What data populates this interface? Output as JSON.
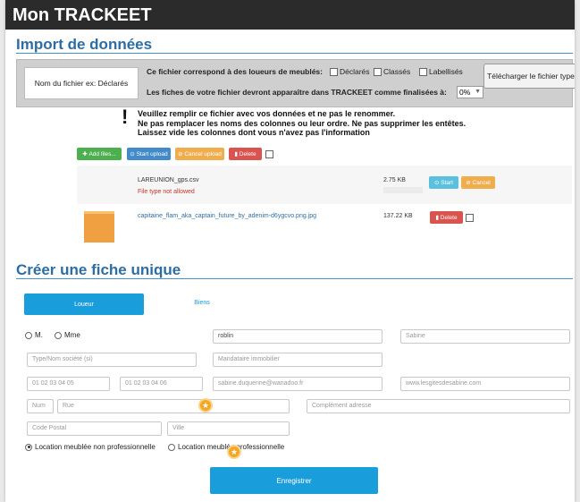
{
  "header": {
    "title": "Mon TRACKEET"
  },
  "import": {
    "heading": "Import de données",
    "file_name_label": "Nom du fichier ex: Déclarés",
    "question1": "Ce fichier correspond à des loueurs de meublés:",
    "options": [
      "Déclarés",
      "Classés",
      "Labellisés"
    ],
    "question2": "Les fiches de votre fichier devront apparaître dans TRACKEET comme finalisées à:",
    "percent_value": "0%",
    "download_button": "Télécharger le fichier type",
    "instructions": [
      "Veuillez remplir ce fichier avec vos données et ne pas le renommer.",
      "Ne pas remplacer les noms des colonnes ou leur ordre. Ne pas supprimer les entêtes.",
      "Laissez vide les colonnes dont vous n'avez pas l'information"
    ],
    "toolbar": {
      "add": "Add files...",
      "start": "Start upload",
      "cancel": "Cancel upload",
      "delete": "Delete"
    },
    "files": [
      {
        "name": "LAREUNION_gps.csv",
        "error": "File type not allowed",
        "size": "2.75 KB",
        "start": "Start",
        "cancel": "Cancel"
      },
      {
        "name": "capitaine_flam_aka_captain_future_by_adenim-d6ygcvo.png.jpg",
        "size": "137.22 KB",
        "delete": "Delete"
      }
    ]
  },
  "create": {
    "heading": "Créer une fiche unique",
    "tabs": [
      "Loueur",
      "Biens"
    ],
    "civility": [
      "M.",
      "Mme"
    ],
    "fields": {
      "lastname": "roblin",
      "firstname": "Sabine",
      "company": "Type/Nom société (si)",
      "agent": "Mandataire immobilier",
      "phone1": "01 02 03 04 05",
      "phone2": "01 02 03 04 06",
      "email": "sabine.duquenne@wanadoo.fr",
      "website": "www.lesgitesdesabine.com",
      "num": "Num",
      "street": "Rue",
      "complement": "Complément adresse",
      "postal": "Code Postal",
      "city": "Ville"
    },
    "rental_types": [
      "Location meublée non professionnelle",
      "Location meublée professionnelle"
    ],
    "save_button": "Enregistrer"
  },
  "colors": {
    "accent": "#1a9ddb",
    "heading": "#2e6da4",
    "topbar": "#2b2b2b"
  }
}
